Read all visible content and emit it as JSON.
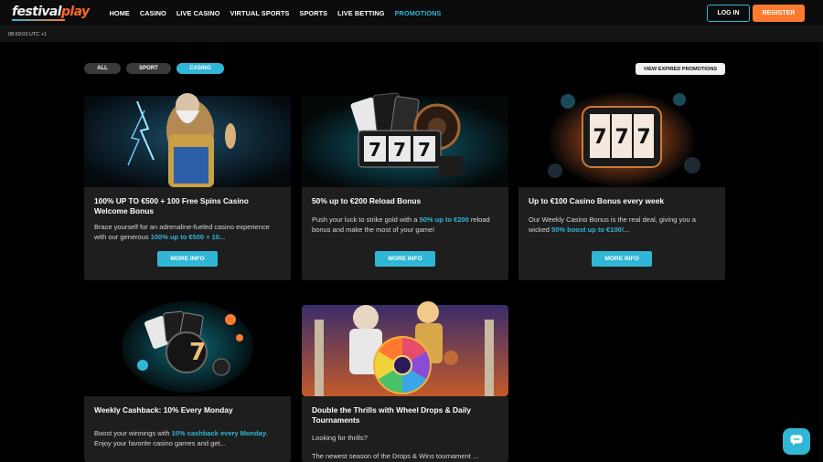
{
  "brand": {
    "name_part1": "festival",
    "name_part2": "play"
  },
  "nav": [
    {
      "label": "HOME",
      "active": false
    },
    {
      "label": "CASINO",
      "active": false
    },
    {
      "label": "LIVE CASINO",
      "active": false
    },
    {
      "label": "VIRTUAL SPORTS",
      "active": false
    },
    {
      "label": "SPORTS",
      "active": false
    },
    {
      "label": "LIVE BETTING",
      "active": false
    },
    {
      "label": "PROMOTIONS",
      "active": true
    }
  ],
  "auth": {
    "login_label": "LOG IN",
    "register_label": "REGISTER"
  },
  "clock": {
    "text": "08:59:03 UTC +1"
  },
  "filters": {
    "all": "ALL",
    "sport": "SPORT",
    "casino": "CASINO",
    "selected": "CASINO"
  },
  "expired_button": "VIEW EXPIRED PROMOTIONS",
  "colors": {
    "accent": "#2fb7d5",
    "brand_orange": "#ff7a2e",
    "card_bg": "#1e1e1e",
    "page_bg": "#000000"
  },
  "promotions": [
    {
      "title": "100% UP TO €500 + 100 Free Spins Casino Welcome Bonus",
      "desc_pre": "Brace yourself for an adrenaline-fueled casino experience with our generous ",
      "desc_hl": "100% up to €500 + 10...",
      "desc_post": "",
      "button": "MORE INFO",
      "image": "zeus-lightning"
    },
    {
      "title": "50% up to €200 Reload Bonus",
      "desc_pre": "Push your luck to strike gold with a ",
      "desc_hl": "50% up to €200",
      "desc_post": " reload bonus and make the most of your game!",
      "button": "MORE INFO",
      "image": "slot-777-cards-roulette"
    },
    {
      "title": "Up to €100 Casino Bonus every week",
      "desc_pre": "Our Weekly Casino Bonus is the real deal, giving you a wicked ",
      "desc_hl": "50% boost up to €100!",
      "desc_post": "...",
      "button": "MORE INFO",
      "image": "slot-reel-777"
    },
    {
      "title": "Weekly Cashback: 10% Every Monday",
      "desc_pre": "Boost your winnings with ",
      "desc_hl": "10% cashback every Monday",
      "desc_post": ". Enjoy your favorite casino games and get...",
      "image": "cards-chips-7"
    },
    {
      "title": "Double the Thrills with Wheel Drops & Daily Tournaments",
      "desc_pre": "Looking for thrills?",
      "desc_line2": "The newest season of the Drops & Wins tournament ...",
      "image": "gods-wheel"
    }
  ],
  "chat": {
    "icon": "chat-icon"
  }
}
